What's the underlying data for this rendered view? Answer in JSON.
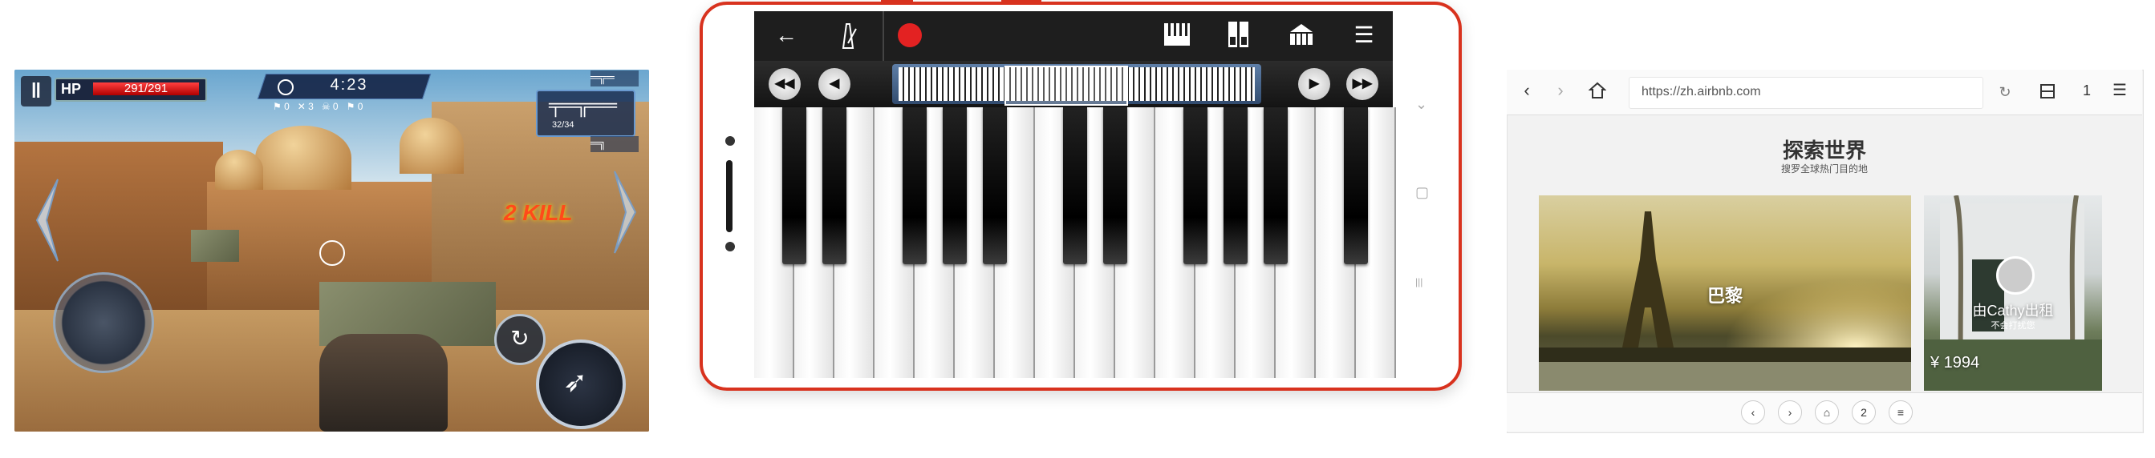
{
  "game": {
    "hp_label": "HP",
    "hp_value": "291/291",
    "timer": "4:23",
    "ammo": "32/34",
    "kill_text": "2 KILL",
    "icons": {
      "pause": "pause-icon",
      "clock": "clock-icon",
      "crosshair": "crosshair-icon",
      "reload": "reload-icon",
      "fire": "fire-icon",
      "joystick": "joystick-icon"
    }
  },
  "piano": {
    "toolbar": {
      "back": "←",
      "metronome": "metronome-icon",
      "record": "record-icon",
      "keys_icon": "piano-keys-icon",
      "layout_icon": "dual-keyboard-icon",
      "style_icon": "piano-icon",
      "menu": "☰"
    },
    "nav": {
      "rewind": "◀◀",
      "prev": "◀",
      "next": "▶",
      "forward": "▶▶"
    },
    "accent_color": "#d8321e",
    "side_nav": {
      "chevron": "⌄",
      "square": "▢",
      "lines": "|||"
    }
  },
  "browser": {
    "url": "https://zh.airbnb.com",
    "tab_count": "1",
    "heading": "探索世界",
    "subheading": "搜罗全球热门目的地",
    "card1_label": "巴黎",
    "card2_label": "由Cathy出租",
    "card2_sub": "不会打扰您",
    "card2_price": "¥ 1994",
    "bottom_page": "2"
  }
}
